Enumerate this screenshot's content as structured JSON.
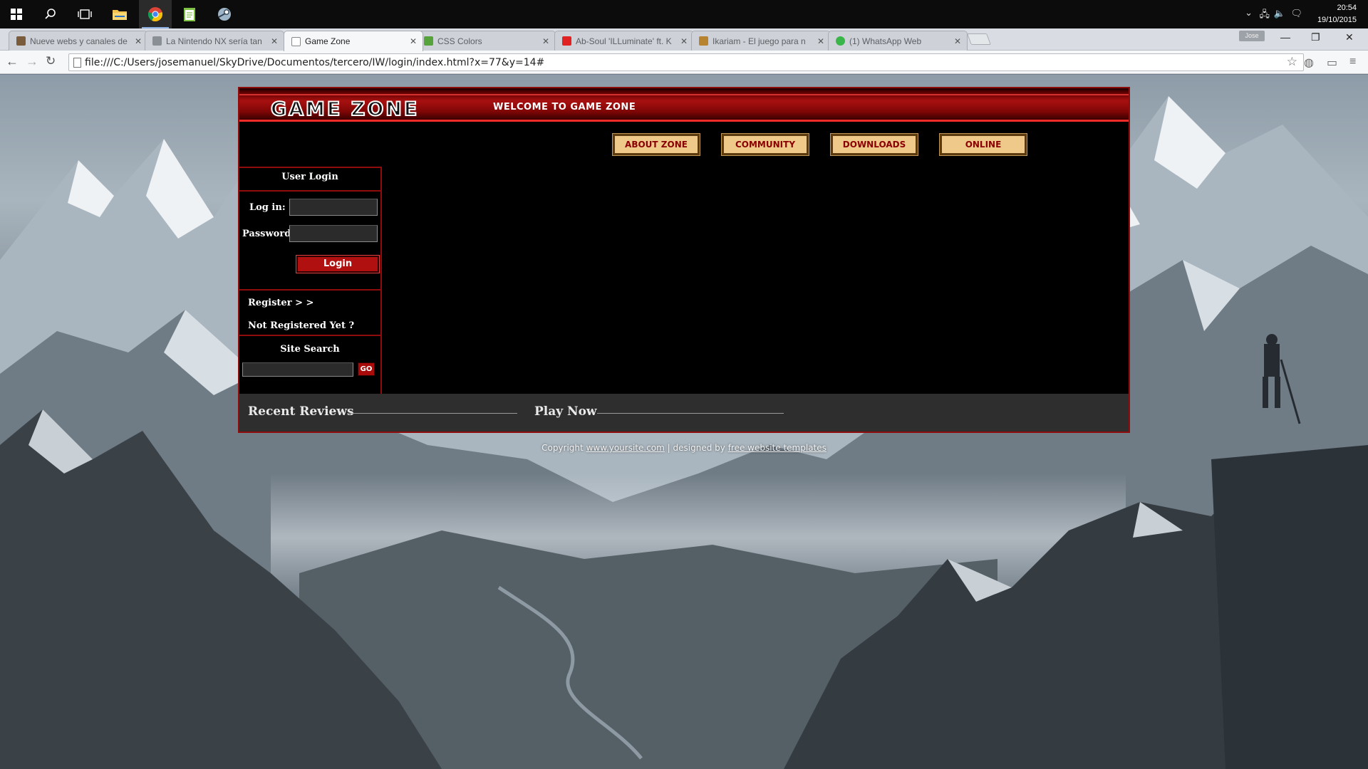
{
  "taskbar": {
    "time": "20:54",
    "date": "19/10/2015"
  },
  "browser": {
    "tabs": [
      {
        "title": "Nueve webs y canales de",
        "favicon_color": "#7a5b3c",
        "active": false
      },
      {
        "title": "La Nintendo NX sería tan",
        "favicon_color": "#8a8f96",
        "active": false
      },
      {
        "title": "Game Zone",
        "favicon_color": "#ffffff",
        "active": true
      },
      {
        "title": "CSS Colors",
        "favicon_color": "#56a33b",
        "active": false
      },
      {
        "title": "Ab-Soul 'ILLuminate' ft. K",
        "favicon_color": "#e02222",
        "active": false
      },
      {
        "title": "Ikariam - El juego para n",
        "favicon_color": "#b8832e",
        "active": false
      },
      {
        "title": "(1) WhatsApp Web",
        "favicon_color": "#3ab54a",
        "active": false
      }
    ],
    "profile_label": "Jose",
    "address": "file:///C:/Users/josemanuel/SkyDrive/Documentos/tercero/IW/login/index.html?x=77&y=14#"
  },
  "site": {
    "logo": "GAME ZONE",
    "welcome": "WELCOME TO GAME ZONE",
    "nav": [
      "ABOUT ZONE",
      "COMMUNITY",
      "DOWNLOADS",
      "ONLINE"
    ],
    "login": {
      "title": "User Login",
      "login_label": "Log in:",
      "login_value": "",
      "password_label": "Password:",
      "password_value": "",
      "button": "Login"
    },
    "register": {
      "link": "Register > >",
      "note": "Not Registered Yet ?"
    },
    "search": {
      "title": "Site Search",
      "value": "",
      "button": "GO"
    },
    "footer_bar": {
      "reviews": "Recent Reviews",
      "play": "Play Now"
    },
    "copyright": {
      "prefix": "Copyright",
      "link1": "www.yoursite.com",
      "middle": "| designed by",
      "link2": "free website templates"
    },
    "colors": {
      "accent_red": "#8e0c0c",
      "nav_gold": "#eec989",
      "panel_dark": "#2e2e2e"
    }
  }
}
